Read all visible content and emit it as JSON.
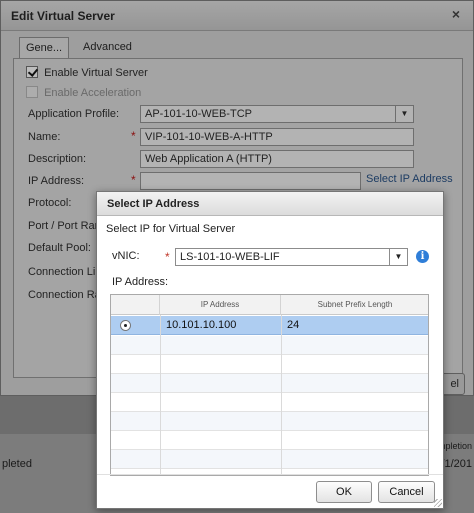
{
  "background": {
    "left_text": "pleted",
    "right_header": "mpletion",
    "right_value": "1/1/201"
  },
  "outer_dialog": {
    "title": "Edit Virtual Server",
    "close_glyph": "×",
    "tabs": [
      {
        "label": "Gene..."
      },
      {
        "label": "Advanced"
      }
    ],
    "enable_virtual_server": {
      "label": "Enable Virtual Server",
      "checked": true
    },
    "enable_acceleration": {
      "label": "Enable Acceleration",
      "checked": false,
      "disabled": true
    },
    "fields": {
      "application_profile": {
        "label": "Application Profile:",
        "value": "AP-101-10-WEB-TCP"
      },
      "name": {
        "label": "Name:",
        "value": "VIP-101-10-WEB-A-HTTP",
        "required_mark": "*"
      },
      "description": {
        "label": "Description:",
        "value": "Web Application A (HTTP)"
      },
      "ip_address": {
        "label": "IP Address:",
        "value": "",
        "required_mark": "*",
        "link": "Select IP Address"
      },
      "protocol": {
        "label": "Protocol:"
      },
      "port": {
        "label": "Port / Port Rang"
      },
      "default_pool": {
        "label": "Default Pool:"
      },
      "connection_limit": {
        "label": "Connection Limi"
      },
      "connection_rate": {
        "label": "Connection Rate"
      }
    },
    "cancel_partial": "el"
  },
  "inner_dialog": {
    "title": "Select IP Address",
    "subtitle": "Select IP for Virtual Server",
    "vnic": {
      "label": "vNIC:",
      "required_mark": "*",
      "value": "LS-101-10-WEB-LIF"
    },
    "info_glyph": "i",
    "ip_label": "IP Address:",
    "table": {
      "columns": [
        "IP Address",
        "Subnet Prefix Length"
      ],
      "rows": [
        {
          "selected": true,
          "ip": "10.101.10.100",
          "prefix": "24"
        }
      ]
    },
    "ok_label": "OK",
    "cancel_label": "Cancel"
  },
  "colors": {
    "selected_row": "#aecdf1",
    "info_blue": "#2f7ed8",
    "required_red": "#c0392b"
  }
}
